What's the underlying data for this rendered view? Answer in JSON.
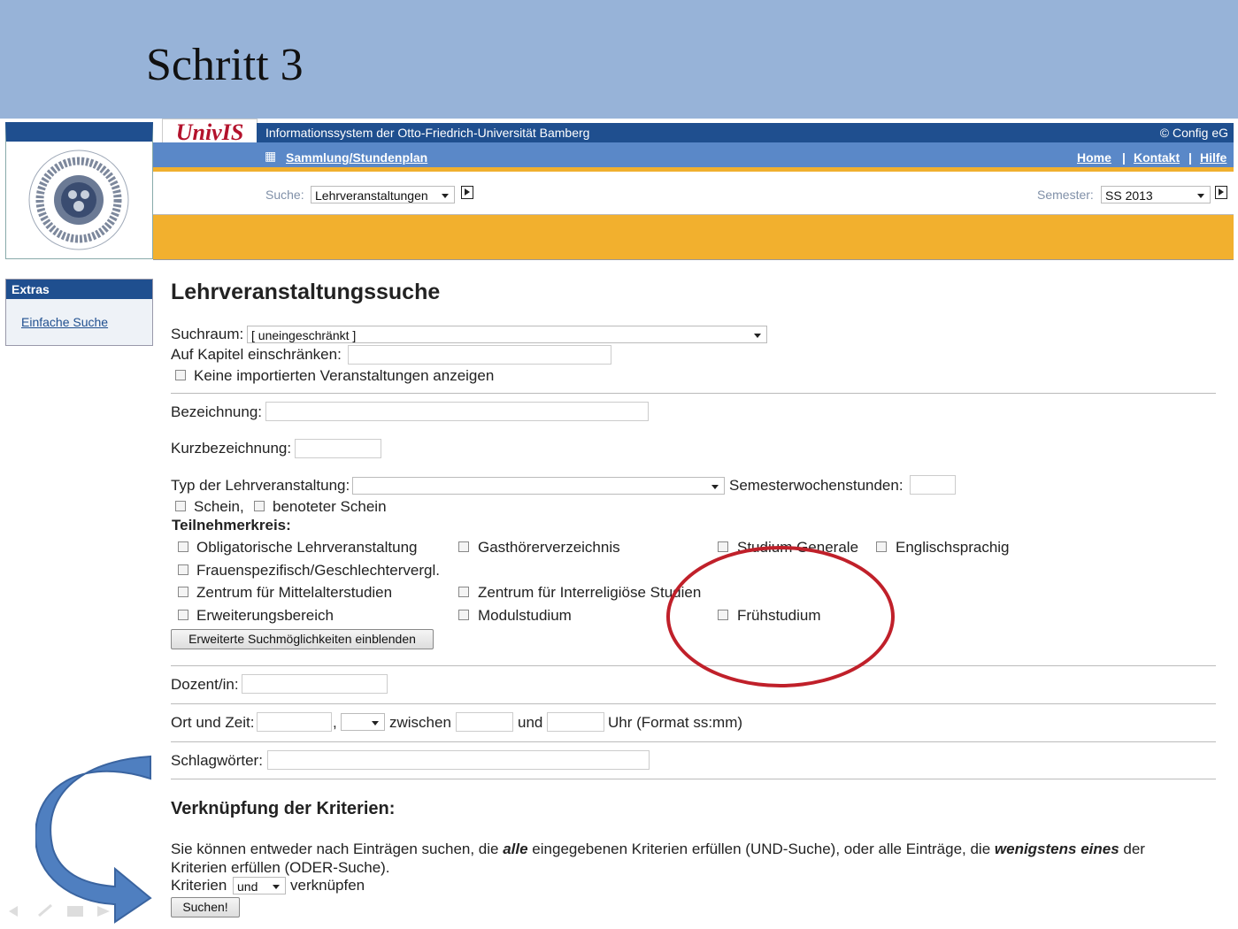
{
  "slide": {
    "title": "Schritt 3"
  },
  "header": {
    "logo_text": "UnivIS",
    "tagline": "Informationssystem der Otto-Friedrich-Universität Bamberg",
    "copyright": "© Config eG",
    "nav": {
      "collection_icon": "▦",
      "collection": "Sammlung/Stundenplan",
      "home": "Home",
      "sep": "|",
      "contact": "Kontakt",
      "help": "Hilfe"
    },
    "search": {
      "label": "Suche:",
      "value": "Lehrveranstaltungen"
    },
    "semester": {
      "label": "Semester:",
      "value": "SS 2013"
    }
  },
  "sidebar": {
    "title": "Extras",
    "link": "Einfache Suche"
  },
  "form": {
    "heading": "Lehrveranstaltungssuche",
    "suchraum_label": "Suchraum:",
    "suchraum_value": "[ uneingeschränkt ]",
    "kapitel_label": "Auf Kapitel einschränken:",
    "no_imported": "Keine importierten Veranstaltungen anzeigen",
    "bezeichnung": "Bezeichnung:",
    "kurzbezeichnung": "Kurzbezeichnung:",
    "typ": "Typ der Lehrveranstaltung:",
    "sws": "Semesterwochenstunden:",
    "schein": "Schein,",
    "benoteter_schein": "benoteter Schein",
    "teilnehmerkreis": "Teilnehmerkreis:",
    "options": {
      "obligatorisch": "Obligatorische Lehrveranstaltung",
      "gasthoerer": "Gasthörerverzeichnis",
      "studium_generale": "Studium Generale",
      "englisch": "Englischsprachig",
      "frauen": "Frauenspezifisch/Geschlechtervergl.",
      "mittelalter": "Zentrum für Mittelalterstudien",
      "interreligioes": "Zentrum für Interreligiöse Studien",
      "erweiterung": "Erweiterungsbereich",
      "modul": "Modulstudium",
      "frueh": "Frühstudium"
    },
    "extended_button": "Erweiterte Suchmöglichkeiten einblenden",
    "dozent": "Dozent/in:",
    "ort_zeit": "Ort und Zeit:",
    "comma": ",",
    "zwischen": "zwischen",
    "und": "und",
    "uhr_format": "Uhr (Format ss:mm)",
    "schlagwoerter": "Schlagwörter:",
    "verk_heading": "Verknüpfung der Kriterien:",
    "desc_1": "Sie können entweder nach Einträgen suchen, die ",
    "desc_alle": "alle",
    "desc_2": " eingegebenen Kriterien erfüllen (UND-Suche), oder alle Einträge, die ",
    "desc_wenigstens": "wenigstens eines",
    "desc_3": " der Kriterien erfüllen (ODER-Suche).",
    "kriterien": "Kriterien",
    "kriterien_value": "und",
    "verknuepfen": "verknüpfen",
    "submit": "Suchen!"
  },
  "colors": {
    "slide_header": "#97b3d8",
    "univis_blue": "#1f4f8f",
    "orange": "#f2b02e",
    "highlight_circle": "#c0202a",
    "arrow": "#4f7fc0"
  }
}
